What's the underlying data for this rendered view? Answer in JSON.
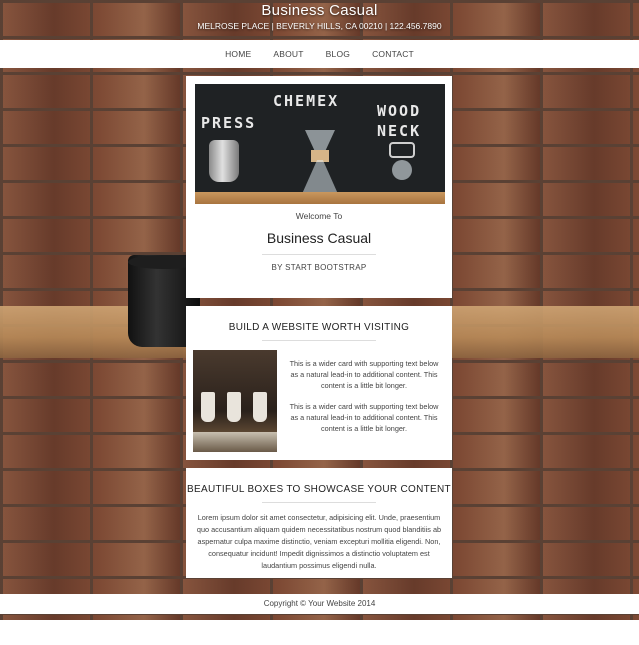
{
  "header": {
    "title": "Business Casual",
    "address": "MELROSE PLACE | BEVERLY HILLS, CA 00210 | 122.456.7890"
  },
  "nav": {
    "items": [
      "HOME",
      "ABOUT",
      "BLOG",
      "CONTACT"
    ]
  },
  "intro_card": {
    "image_words": [
      "CHEMEX",
      "PRESS",
      "WOOD",
      "NECK"
    ],
    "welcome": "Welcome To",
    "title": "Business Casual",
    "byline": "BY START BOOTSTRAP"
  },
  "feature_card": {
    "title": "BUILD A WEBSITE WORTH VISITING",
    "paragraphs": [
      "This is a wider card with supporting text below as a natural lead-in to additional content. This content is a little bit longer.",
      "This is a wider card with supporting text below as a natural lead-in to additional content. This content is a little bit longer."
    ]
  },
  "boxes_card": {
    "title": "BEAUTIFUL BOXES TO SHOWCASE YOUR CONTENT",
    "body": "Lorem ipsum dolor sit amet consectetur, adipisicing elit. Unde, praesentium quo accusantium aliquam quidem necessitatibus nostrum quod blanditiis ab aspernatur culpa maxime distinctio, veniam excepturi mollitia eligendi. Non, consequatur incidunt! Impedit dignissimos a distinctio voluptatem est laudantium possimus eligendi nulla."
  },
  "footer": {
    "copyright": "Copyright © Your Website 2014"
  }
}
